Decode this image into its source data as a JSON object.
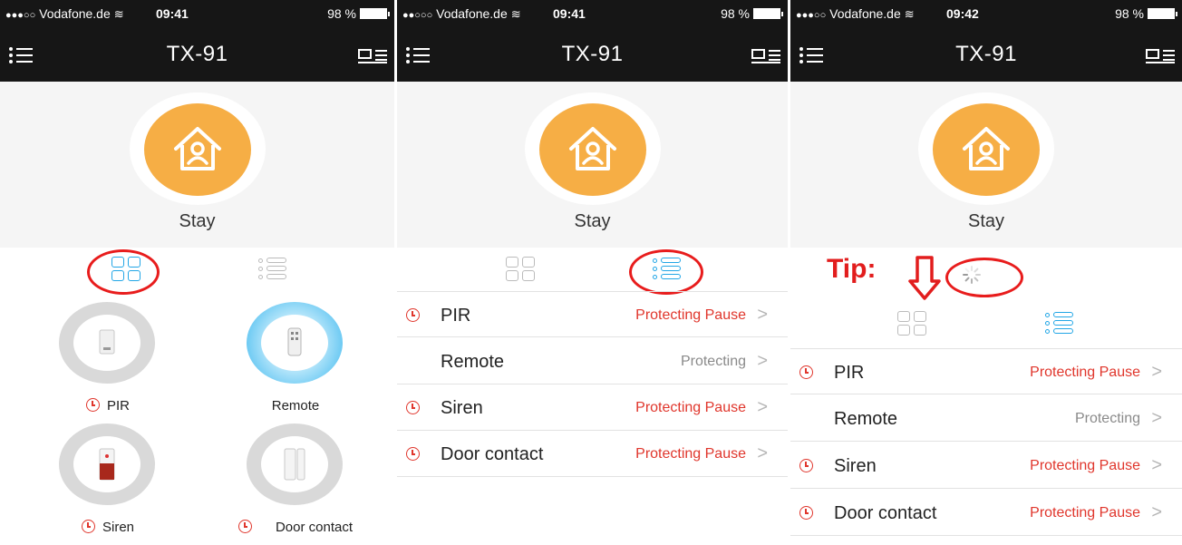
{
  "screens": [
    {
      "status": {
        "carrier": "Vodafone.de",
        "time": "09:41",
        "battery": "98 %"
      },
      "title": "TX-91",
      "mode_label": "Stay",
      "devices": [
        {
          "name": "PIR",
          "timer": true
        },
        {
          "name": "Remote",
          "timer": false
        },
        {
          "name": "Siren",
          "timer": true
        },
        {
          "name": "Door contact",
          "timer": true
        }
      ]
    },
    {
      "status": {
        "carrier": "Vodafone.de",
        "time": "09:41",
        "battery": "98 %"
      },
      "title": "TX-91",
      "mode_label": "Stay",
      "rows": [
        {
          "name": "PIR",
          "status": "Protecting Pause",
          "timer": true
        },
        {
          "name": "Remote",
          "status": "Protecting",
          "timer": false
        },
        {
          "name": "Siren",
          "status": "Protecting Pause",
          "timer": true
        },
        {
          "name": "Door contact",
          "status": "Protecting Pause",
          "timer": true
        }
      ]
    },
    {
      "status": {
        "carrier": "Vodafone.de",
        "time": "09:42",
        "battery": "98 %"
      },
      "title": "TX-91",
      "mode_label": "Stay",
      "tip": "Tip:",
      "rows": [
        {
          "name": "PIR",
          "status": "Protecting Pause",
          "timer": true
        },
        {
          "name": "Remote",
          "status": "Protecting",
          "timer": false
        },
        {
          "name": "Siren",
          "status": "Protecting Pause",
          "timer": true
        },
        {
          "name": "Door contact",
          "status": "Protecting Pause",
          "timer": true
        }
      ]
    }
  ],
  "chevron": ">",
  "colors": {
    "accent": "#22a6e6",
    "mode": "#f6ae45",
    "alert": "#e0362c",
    "annotation": "#e81c1c",
    "bar": "#161616"
  },
  "icons": [
    "menu-icon",
    "message-list-icon",
    "house-person-icon",
    "grid-view-icon",
    "list-view-icon",
    "clock-icon",
    "spinner-icon",
    "down-arrow-icon"
  ]
}
